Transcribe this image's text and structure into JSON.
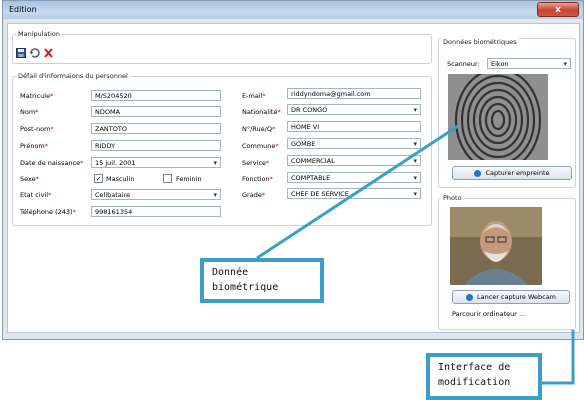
{
  "window": {
    "title": "Edition",
    "close_glyph": "x"
  },
  "manipulation": {
    "title": "Manipulation",
    "icons": [
      "save-icon",
      "refresh-icon",
      "delete-icon"
    ]
  },
  "personnel": {
    "title": "Défail d'informaions du personnel",
    "left": [
      {
        "label": "Matricule",
        "required": true,
        "value": "M/S204520",
        "select": false
      },
      {
        "label": "Nom",
        "required": true,
        "value": "NDOMA",
        "select": false
      },
      {
        "label": "Post-nom",
        "required": true,
        "value": "ZANTOTO",
        "select": false
      },
      {
        "label": "Prénom",
        "required": true,
        "value": "RIDDY",
        "select": false
      },
      {
        "label": "Date de naissance",
        "required": true,
        "value": "15 juil. 2001",
        "select": true
      }
    ],
    "sexe": {
      "label": "Sexe",
      "masculin": "Masculin",
      "feminin": "Feminin",
      "masculin_checked": "✓",
      "feminin_checked": ""
    },
    "etat_civil": {
      "label": "Etat civil",
      "value": "Celibataire"
    },
    "telephone": {
      "label": "Téléphone (243)",
      "value": "998161354"
    },
    "right": [
      {
        "label": "E-mail",
        "value": "riddyndoma@gmail.com",
        "select": false
      },
      {
        "label": "Nationalité",
        "value": "DR CONGO",
        "select": true
      },
      {
        "label": "N°/Rue/Q",
        "value": "HOME VI",
        "select": false
      },
      {
        "label": "Commune",
        "value": "GOMBE",
        "select": true
      },
      {
        "label": "Service",
        "value": "COMMERCIAL",
        "select": true
      },
      {
        "label": "Fonction",
        "value": "COMPTABLE",
        "select": true
      },
      {
        "label": "Grade",
        "value": "CHEF DE SERVICE",
        "select": true
      }
    ]
  },
  "biometrics": {
    "title": "Données biométriques",
    "scanner_label": "Scanneur:",
    "scanner_value": "Eikon",
    "capture_button": "Capturer empreinte"
  },
  "photo": {
    "title": "Photo",
    "webcam_button": "Lancer capture Webcam",
    "browse_link": "Parcourir ordinateur ..."
  },
  "callouts": {
    "biometric": [
      "Donnée",
      "biométrique"
    ],
    "interface": [
      "Interface de",
      "modification"
    ]
  },
  "colors": {
    "callout_border": "#3aa0c8",
    "required": "#e00000",
    "title_bar": "#b6cce6"
  }
}
